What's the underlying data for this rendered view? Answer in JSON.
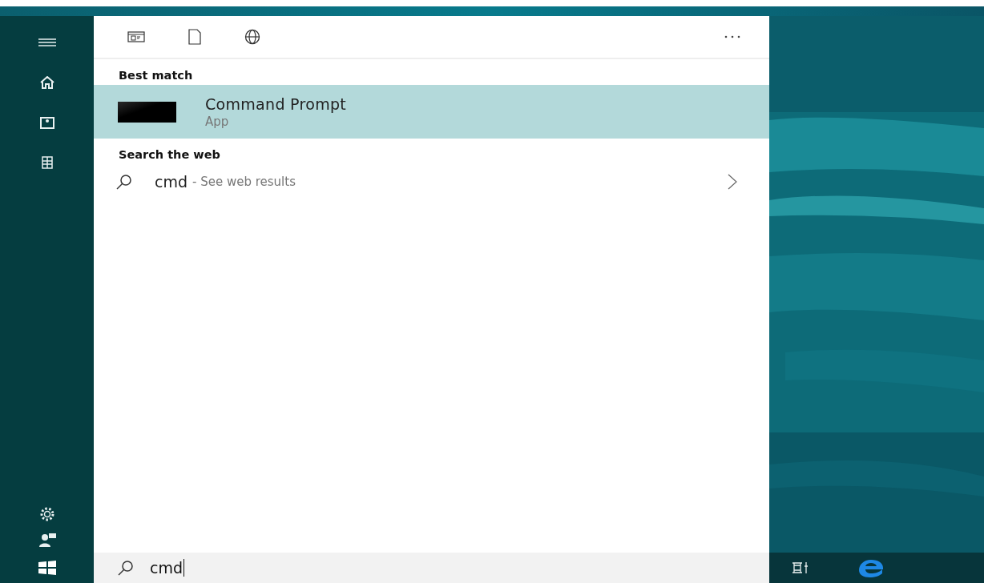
{
  "sections": [
    {
      "heading": "Best match",
      "items": [
        {
          "kind": "app",
          "title": "Command Prompt",
          "subtitle": "App",
          "selected": true
        }
      ]
    },
    {
      "heading": "Search the web",
      "items": [
        {
          "kind": "web",
          "query": "cmd",
          "hint": "- See web results",
          "selected": false
        }
      ]
    }
  ],
  "search_box": {
    "value": "cmd"
  }
}
